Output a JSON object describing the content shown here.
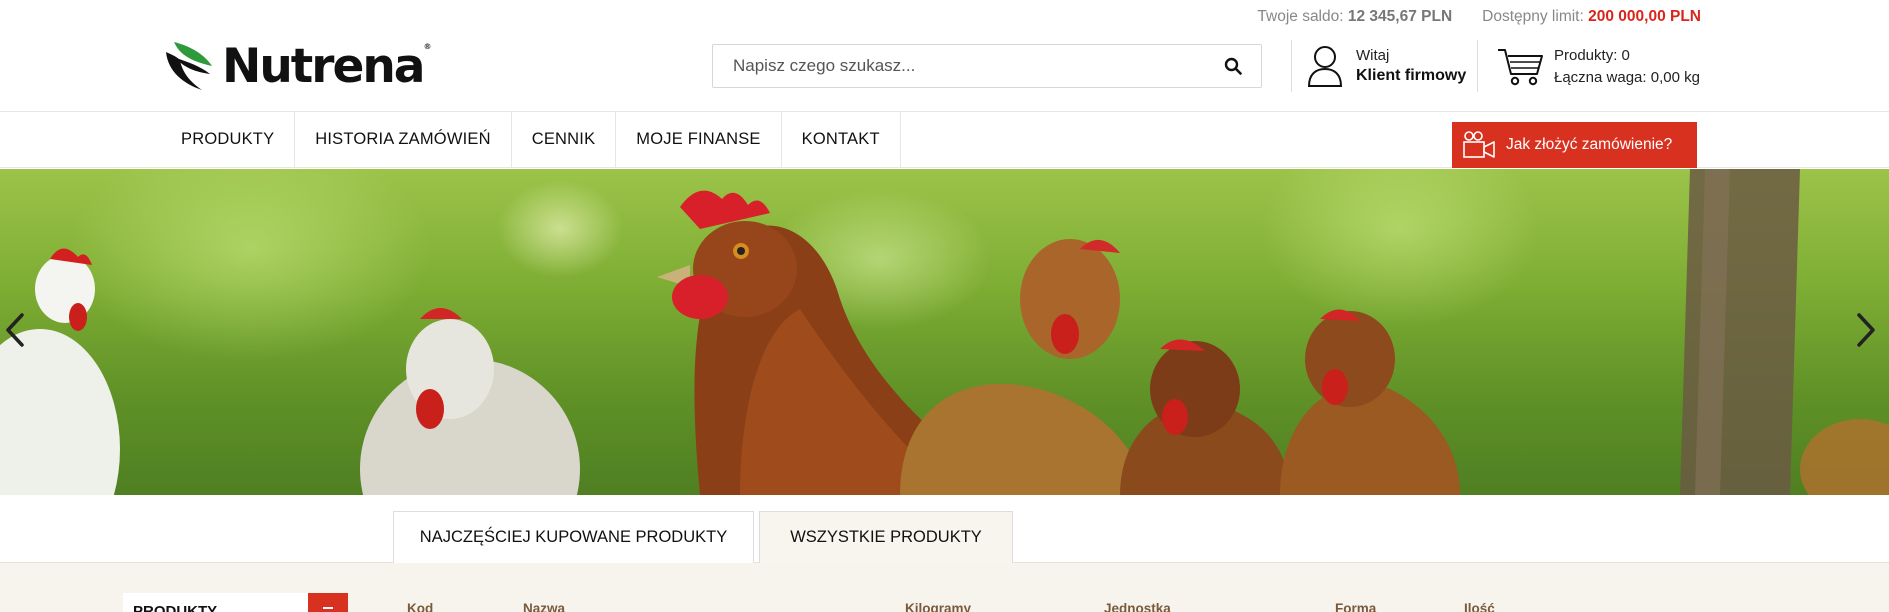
{
  "topbar": {
    "balance_label": "Twoje saldo:",
    "balance_value": "12 345,67 PLN",
    "limit_label": "Dostępny limit:",
    "limit_value": "200 000,00 PLN"
  },
  "logo": {
    "text": "Nutrena",
    "reg": "®"
  },
  "search": {
    "placeholder": "Napisz czego szukasz..."
  },
  "account": {
    "greeting": "Witaj",
    "name": "Klient firmowy"
  },
  "cart": {
    "products": "Produkty: 0",
    "weight": "Łączna waga: 0,00 kg"
  },
  "nav": {
    "items": [
      "PRODUKTY",
      "HISTORIA ZAMÓWIEŃ",
      "CENNIK",
      "MOJE FINANSE",
      "KONTAKT"
    ],
    "howto": "Jak złożyć zamówienie?"
  },
  "tabs": [
    "NAJCZĘŚCIEJ KUPOWANE PRODUKTY",
    "WSZYSTKIE PRODUKTY"
  ],
  "sidebar": {
    "label": "PRODUKTY"
  },
  "table": {
    "columns": [
      "Kod",
      "Nazwa",
      "Kilogramy",
      "Jednostka",
      "Forma",
      "Ilość"
    ]
  },
  "colors": {
    "accent": "#d9311f",
    "limit": "#d9261c",
    "panel": "#f7f3ed"
  }
}
